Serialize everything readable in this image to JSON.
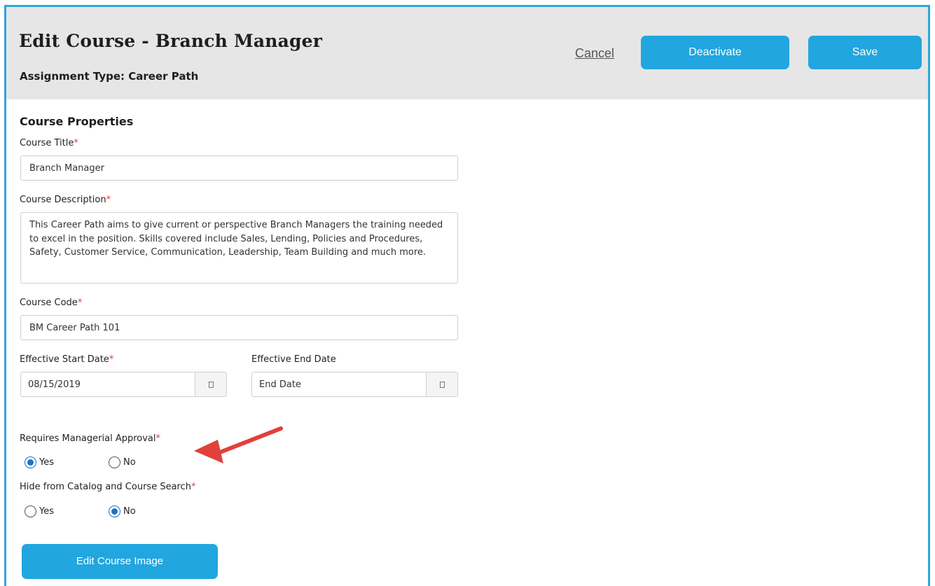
{
  "header": {
    "title": "Edit Course - Branch Manager",
    "assignment_type": "Assignment Type: Career Path",
    "cancel_label": "Cancel",
    "deactivate_label": "Deactivate",
    "save_label": "Save",
    "accent_color": "#21a6df"
  },
  "form": {
    "section_title": "Course Properties",
    "required_marker": "*",
    "course_title": {
      "label": "Course Title",
      "value": "Branch Manager"
    },
    "course_description": {
      "label": "Course Description",
      "value": "This Career Path aims to give current or perspective Branch Managers the training needed to excel in the position.  Skills covered include Sales, Lending, Policies and Procedures, Safety, Customer Service, Communication, Leadership, Team Building and much more."
    },
    "course_code": {
      "label": "Course Code",
      "value": "BM Career Path 101"
    },
    "start_date": {
      "label": "Effective Start Date",
      "value": "08/15/2019",
      "icon": "calendar-icon"
    },
    "end_date": {
      "label": "Effective End Date",
      "placeholder": "End Date",
      "icon": "calendar-icon"
    },
    "managerial_approval": {
      "label": "Requires Managerial Approval",
      "options": [
        "Yes",
        "No"
      ],
      "selected": "Yes"
    },
    "hide_from_catalog": {
      "label": "Hide from Catalog and Course Search",
      "options": [
        "Yes",
        "No"
      ],
      "selected": "No"
    },
    "edit_image_label": "Edit Course Image"
  },
  "annotation": {
    "arrow_color": "#e0413a"
  }
}
